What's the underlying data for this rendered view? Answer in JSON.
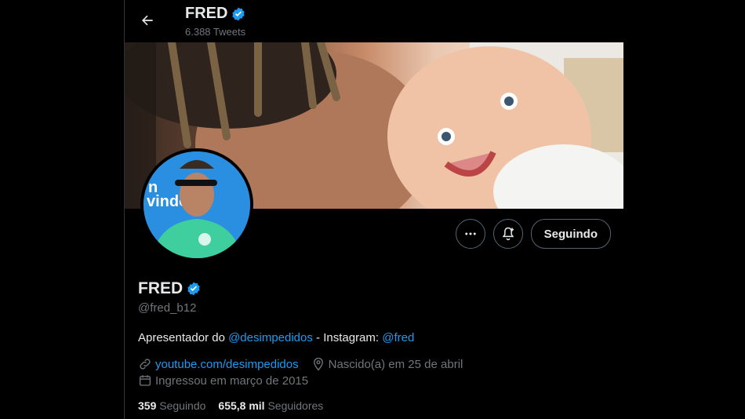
{
  "header": {
    "name": "FRED",
    "tweet_count": "6.388 Tweets"
  },
  "profile": {
    "name": "FRED",
    "handle": "@fred_b12",
    "bio_prefix": "Apresentador do ",
    "bio_mention_1": "@desimpedidos",
    "bio_middle": " - Instagram: ",
    "bio_mention_2": "@fred",
    "website": "youtube.com/desimpedidos",
    "birthday": "Nascido(a) em 25 de abril",
    "joined": "Ingressou em março de 2015",
    "following_count": "359",
    "following_label": "Seguindo",
    "followers_count": "655,8 mil",
    "followers_label": "Seguidores",
    "avatar_banner_text": "n\nvindos!"
  },
  "actions": {
    "follow_label": "Seguindo"
  },
  "colors": {
    "accent": "#1d9bf0",
    "muted": "#71767b",
    "text": "#e7e9ea",
    "background": "#000000"
  },
  "icons": [
    "back-arrow-icon",
    "verified-badge-icon",
    "more-icon",
    "notification-bell-icon",
    "link-icon",
    "location-icon",
    "calendar-icon"
  ]
}
